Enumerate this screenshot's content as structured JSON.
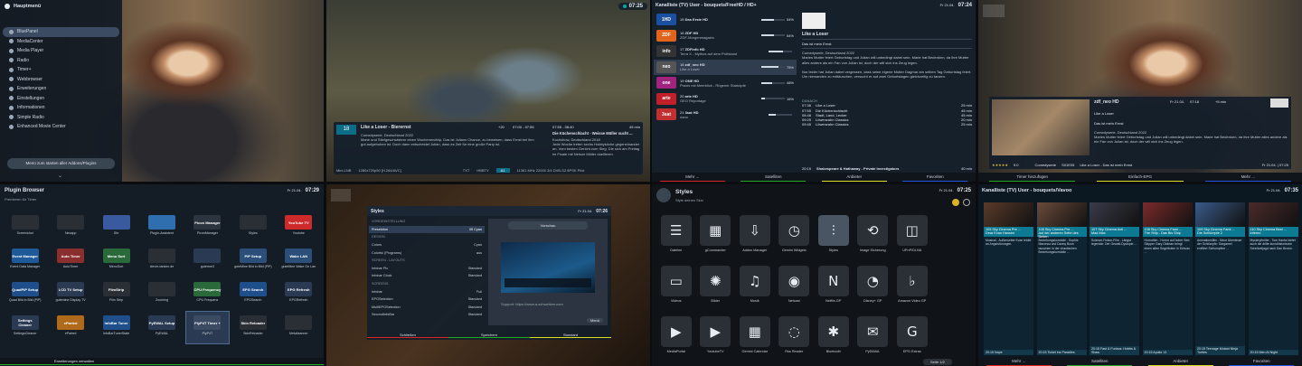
{
  "p1": {
    "title": "Hauptmenü",
    "items": [
      "BluePanel",
      "MediaCenter",
      "Media Player",
      "Radio",
      "Timer+",
      "Webbrowser",
      "Erweiterungen",
      "Einstellungen",
      "Informationen",
      "Simple Radio",
      "Enhanced Movie Center"
    ],
    "footer_btn": "Menü zum starten aller Addons/Plugins"
  },
  "p2": {
    "clock": "07:25",
    "channel_num": "18",
    "title": "Like a Loser - Bierernst",
    "time": "07:00 - 07:55",
    "remain": "+20",
    "desc": "Comedyserie, Deutschland 2022\nMarie und Stiefgeschwistern einen Wochenendtrip. Das ist Julians Chance, zu beweisen, dass Ernst bei ihm gut aufgehoben ist. Doch dann entscheidet Julian, dass es Zeit für eine große Party ist.",
    "next_time": "07:55 - 08:40",
    "next_dur": "45 min",
    "next_title": "Die Küchenschlacht - Weisse Müller sucht ...",
    "next_desc": "Kochshow, Deutschland 2018\nJede Woche treten sechs Hobbyköche gegeneinander an. Vom besten Gericht zum Sieg. Die sich am Freitag im Finale mit Nelson Müller duellieren.",
    "sat": "Mini-LNB",
    "res": "1280x720p50 [H.264/AVC]",
    "badges": [
      "TXT",
      "HBBTV",
      "A1"
    ],
    "freq": "11361 MHz 22000 3/4 DVB-S2 8PSK Pilot"
  },
  "p3": {
    "header": "Kanalliste (TV) User - bouquets/FreeHD / HD+",
    "date": "Fr 21.04.",
    "clock": "07:24",
    "channels": [
      {
        "num": "15",
        "name": "Das Erste HD",
        "prog": "",
        "pct": "54%",
        "fill": 0.54,
        "logo": "1HD",
        "color": "#1b4fa0"
      },
      {
        "num": "16",
        "name": "ZDF HD",
        "prog": "ZDF-Morgenmagazin",
        "pct": "54%",
        "fill": 0.54,
        "logo": "ZDF",
        "color": "#e0641b"
      },
      {
        "num": "17",
        "name": "ZDFinfo HD",
        "prog": "Terra X - Mythos auf dem Prüfstand",
        "pct": "",
        "fill": 0.6,
        "logo": "info",
        "color": "#333"
      },
      {
        "num": "18",
        "name": "zdf_neo HD",
        "prog": "Like a Loser",
        "pct": "75%",
        "fill": 0.75,
        "logo": "neo",
        "color": "#555"
      },
      {
        "num": "19",
        "name": "ONE HD",
        "prog": "Praxis mit Meerblick - Rügener Starköpfe",
        "pct": "48%",
        "fill": 0.48,
        "logo": "one",
        "color": "#a0247d"
      },
      {
        "num": "20",
        "name": "arte HD",
        "prog": "GEO Reportage",
        "pct": "16%",
        "fill": 0.16,
        "logo": "arte",
        "color": "#c0202a"
      },
      {
        "num": "21",
        "name": "3sat HD",
        "prog": "nano",
        "pct": "",
        "fill": 0.3,
        "logo": "3sat",
        "color": "#c03030"
      }
    ],
    "info_title": "Like a Loser",
    "info_sub": "Das ist mein Ernst",
    "info_desc": "Comedyserie, Deutschland 2022\nMaries Mutter feiert Geburtstag und Julian will unbedingt dabei sein. Marie hat Bedenken, da ihre Mutter alles andere als ein Fan von Julian ist, doch der will sich ins Zeug legen.\n\nNur leider hat Julian dabei vergessen, dass seine eigene Mutter Dagmar am selben Tag Geburtstag feiert. Um niemanden zu enttäuschen, versucht er auf zwei Geburtstagen gleichzeitig zu tanzen.",
    "danach": "DANACH",
    "after": [
      {
        "t": "07:36",
        "n": "Like a Loser",
        "d": "25 min"
      },
      {
        "t": "07:55",
        "n": "Die Küchenschlacht",
        "d": "45 min"
      },
      {
        "t": "08:48",
        "n": "Stadt, Land, Lecker",
        "d": "45 min"
      },
      {
        "t": "09:25",
        "n": "Löwenzahn Classics",
        "d": "20 min"
      },
      {
        "t": "09:45",
        "n": "Löwenzahn Classics",
        "d": "25 min"
      }
    ],
    "prime_t": "20:15",
    "prime_n": "Shakespeare & Hathaway - Private Investigators",
    "prime_d": "40 min",
    "buttons": [
      "Mehr ...",
      "Satelliten",
      "Anbieter",
      "Favoriten"
    ]
  },
  "p4": {
    "channel": "zdf_neo HD",
    "date": "Fr 21.04.",
    "time": "07:18",
    "plus": "+5 min",
    "title": "Like a Loser",
    "sub": "Das ist mein Ernst",
    "desc": "Comedyserie, Deutschland 2022\nMaries Mutter feiert Geburtstag und Julian will unbedingt dabei sein. Marie hat Bedenken, da ihre Mutter alles andere als ein Fan von Julian ist, doch der will sich ins Zeug legen.",
    "rating": "9.0",
    "genre": "Comedyserie",
    "episode": "S01E05",
    "ep_title": "Like a Loser - Das ist mein Ernst",
    "end": "Fr 21.04. | 07:25",
    "buttons": [
      "Timer hinzufügen",
      "Einfach-EPG",
      "Mehr ..."
    ]
  },
  "p5": {
    "title": "Plugin Browser",
    "subtitle": "Premieren für Timer",
    "date": "Fr 21.04.",
    "clock": "07:29",
    "plugins": [
      {
        "n": "Screenshot",
        "l": "",
        "c": "#2a2f36"
      },
      {
        "n": "Nexapp",
        "l": "",
        "c": "#2a2f36"
      },
      {
        "n": "Shr",
        "l": "",
        "c": "#3a5aa0"
      },
      {
        "n": "Plugin-Assistent",
        "l": "",
        "c": "#2f6fb0"
      },
      {
        "n": "PiconManager",
        "l": "Picon Manager",
        "c": "#2c3440"
      },
      {
        "n": "Styles",
        "l": "",
        "c": "#2a2f36"
      },
      {
        "n": "Youtube",
        "l": "YouTube TV",
        "c": "#cf2a2a"
      },
      {
        "n": "Event Data Manager",
        "l": "Event Manager",
        "c": "#1e5a9a"
      },
      {
        "n": "AutoTimer",
        "l": "Auto Timer",
        "c": "#8b2e2e"
      },
      {
        "n": "MenuSort",
        "l": "Menu Sort",
        "c": "#2a6a3a"
      },
      {
        "n": "clever-tanken.de",
        "l": "",
        "c": "#2a2f36"
      },
      {
        "n": "guterme3",
        "l": "",
        "c": "#2a3a52"
      },
      {
        "n": "guteMine Bild in Bild (PiP)",
        "l": "PiP Setup",
        "c": "#2c4f7a"
      },
      {
        "n": "guteMine Wake On Lan",
        "l": "Wake LAN",
        "c": "#2c4f7a"
      },
      {
        "n": "Quad Bild in Bild (PiP)",
        "l": "QuadPiP Setup",
        "c": "#1e4f8a"
      },
      {
        "n": "gutemine Display TV",
        "l": "LCD TV Setup",
        "c": "#2a3a52"
      },
      {
        "n": "Film Strip",
        "l": "FilmStrip",
        "c": "#2a2f36"
      },
      {
        "n": "Zooming",
        "l": "",
        "c": "#2a2f36"
      },
      {
        "n": "CPU Frequenz",
        "l": "CPU Frequency",
        "c": "#2a6a3a"
      },
      {
        "n": "EPGSearch",
        "l": "EPG Search",
        "c": "#1e4f8a"
      },
      {
        "n": "EPGRefresh",
        "l": "EPG Refresh",
        "c": "#2a3a52"
      },
      {
        "n": "SettingsCleaner",
        "l": "Settings Cleaner",
        "c": "#2a3a52"
      },
      {
        "n": "eParted",
        "l": "eParted",
        "c": "#b06a1a"
      },
      {
        "n": "InfoBarTunerState",
        "l": "InfoBar Tuner",
        "c": "#1e4f8a"
      },
      {
        "n": "PyEWAL",
        "l": "PyEWAL Setup",
        "c": "#2a3a52"
      },
      {
        "n": "PiyP4T",
        "l": "PiyP4T Timer +",
        "c": "#3a4b62"
      },
      {
        "n": "SkinReloader",
        "l": "Skin Reloader",
        "c": "#2a2f36"
      },
      {
        "n": "Metalizanner",
        "l": "",
        "c": "#2a2f36"
      }
    ],
    "footer": "Erweiterungen verwalten"
  },
  "p6": {
    "title": "Styles",
    "date": "Fr 21.04.",
    "clock": "07:26",
    "settings": [
      {
        "k": "VORDEINSTELLUNG",
        "v": "",
        "h": true
      },
      {
        "k": "Presektion",
        "v": "05 Cyan",
        "sel": true
      },
      {
        "k": "DESIGN",
        "v": "",
        "h": true
      },
      {
        "k": "Colors",
        "v": "Cyan"
      },
      {
        "k": "Colorful (Programs)",
        "v": "aus"
      },
      {
        "k": "SCREEN - LAYOUTS",
        "v": "",
        "h": true
      },
      {
        "k": "Infobar Pic",
        "v": "Standard"
      },
      {
        "k": "Infobar Clock",
        "v": "Standard"
      },
      {
        "k": "SCREENS",
        "v": "",
        "h": true
      },
      {
        "k": "Infobar",
        "v": "Full"
      },
      {
        "k": "EPGSelection",
        "v": "Standard"
      },
      {
        "k": "MultiEPGSelection",
        "v": "Standard"
      },
      {
        "k": "SecondInfoBar",
        "v": "Standard"
      }
    ],
    "preview_title": "Vorschau",
    "support": "Support: https://www.a-schweitzer.com",
    "menu_btn": "Menü",
    "buttons": [
      "Schließen",
      "Speichern",
      "Standard"
    ]
  },
  "p7": {
    "title": "Styles",
    "subtitle": "Style deinen Skin",
    "date": "Fr 21.04.",
    "clock": "07:25",
    "icons": [
      {
        "n": "Dateien",
        "g": "☰"
      },
      {
        "n": "gCommander",
        "g": "▦"
      },
      {
        "n": "Addon Manager",
        "g": "⇩"
      },
      {
        "n": "Gemini Widgets",
        "g": "◷"
      },
      {
        "n": "Styles",
        "g": "⫶"
      },
      {
        "n": "Image Sicherung",
        "g": "⟲"
      },
      {
        "n": "UPnP/DLNA",
        "g": "◫"
      },
      {
        "n": "",
        "g": ""
      },
      {
        "n": "Videos",
        "g": "▭"
      },
      {
        "n": "Bilder",
        "g": "✺"
      },
      {
        "n": "Musik",
        "g": "♫"
      },
      {
        "n": "Netcast",
        "g": "◉"
      },
      {
        "n": "Netflix-GP",
        "g": "N"
      },
      {
        "n": "Disney+ GP",
        "g": "◔"
      },
      {
        "n": "Amazon Video GP",
        "g": "♭"
      },
      {
        "n": "",
        "g": ""
      },
      {
        "n": "MediaPortal",
        "g": "▶"
      },
      {
        "n": "YoutubeTV",
        "g": "▶"
      },
      {
        "n": "Gemini Calendar",
        "g": "▦"
      },
      {
        "n": "Rss Reader",
        "g": "◌"
      },
      {
        "n": "Bluetooth",
        "g": "✱"
      },
      {
        "n": "PyDMAIL",
        "g": "✉"
      },
      {
        "n": "EPG Extras",
        "g": "G"
      },
      {
        "n": "",
        "g": ""
      }
    ],
    "page": "Seite 1/2"
  },
  "p8": {
    "header": "Kanalliste (TV) User - bouquets/Vavoo",
    "date": "Fr 21.04.",
    "clock": "07:35",
    "cols": [
      {
        "ch": "105 Sky Cinema Pre ...",
        "t1": "Dear Evan Hansen",
        "desc": "Musical - Außenseiter Evan leidet an Angststörungen.",
        "nx": "20:15 Nope",
        "c": "#5a3a2a"
      },
      {
        "ch": "106 Sky Cinema Pre ...",
        "t1": "Auf der anderen Seite des Betten",
        "desc": "Beziehungskomödie - Sophie Marceau und Danny Boon tauschen in der chaotischen Beziehungskomödie ...",
        "nx": "20:15 Ticket ins Paradies",
        "c": "#6a4a3a"
      },
      {
        "ch": "107 Sky Cinema Acti ...",
        "t1": "Mad Max",
        "desc": "Science-Fiction-Film - Längst legendär: Der Gewalt-Dystopie ...",
        "nx": "20:15 Fast & Furious: Hobbs & Shaw",
        "c": "#3a3a4a"
      },
      {
        "ch": "108 Sky Cinema Fami ...",
        "t1": "The Ship - Das Bis Ship",
        "desc": "Horrorfilm - Horror auf hoher See: Skipper Gary Oldman bringt einen alten Segelboten in Schuss ...",
        "nx": "20:15 Apollo 13",
        "c": "#7a2a2a"
      },
      {
        "ch": "109 Sky Cinema Fami ...",
        "t1": "Die Schlümpfe 2",
        "desc": "Animationsfilm - Neue Abenteuer der Schlümpfe: Gargamel entführt Schlumpfine ...",
        "nx": "20:15 Teenage Mutant Ninja Turtles",
        "c": "#3a5a8a"
      },
      {
        "ch": "110 Sky Cinema Best ...",
        "t1": "Inferno",
        "desc": "Mysterythriller - Tom Hanks bietet auch die dritte kunsthistorische Schnitzeljagd nach Dan Brown.",
        "nx": "20:15 Men At Night",
        "c": "#4a2a2a"
      }
    ],
    "buttons": [
      "Mehr ...",
      "Satelliten",
      "Anbieter",
      "Favoriten"
    ]
  }
}
